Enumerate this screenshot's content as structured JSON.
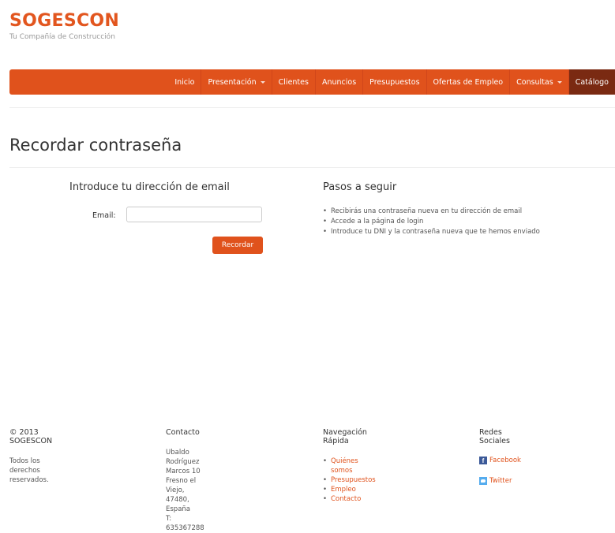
{
  "brand": {
    "name": "SOGESCON",
    "tagline": "Tu Compañía de Construcción"
  },
  "nav": {
    "items": [
      {
        "label": "Inicio",
        "dropdown": false,
        "active": false
      },
      {
        "label": "Presentación",
        "dropdown": true,
        "active": false
      },
      {
        "label": "Clientes",
        "dropdown": false,
        "active": false
      },
      {
        "label": "Anuncios",
        "dropdown": false,
        "active": false
      },
      {
        "label": "Presupuestos",
        "dropdown": false,
        "active": false
      },
      {
        "label": "Ofertas de Empleo",
        "dropdown": false,
        "active": false
      },
      {
        "label": "Consultas",
        "dropdown": true,
        "active": false
      },
      {
        "label": "Catálogo",
        "dropdown": false,
        "active": true
      }
    ]
  },
  "page": {
    "title": "Recordar contraseña"
  },
  "form": {
    "heading": "Introduce tu dirección de email",
    "email_label": "Email:",
    "email_value": "",
    "submit_label": "Recordar"
  },
  "steps": {
    "heading": "Pasos a seguir",
    "items": [
      "Recibirás una contraseña nueva en tu dirección de email",
      "Accede a la página de login",
      "Introduce tu DNI y la contraseña nueva que te hemos enviado"
    ]
  },
  "footer": {
    "copyright": {
      "heading": "© 2013 SOGESCON",
      "text": "Todos los derechos reservados."
    },
    "contact": {
      "heading": "Contacto",
      "lines": [
        "Ubaldo Rodríguez Marcos 10",
        "Fresno el Viejo, 47480, España",
        "T: 635367288"
      ]
    },
    "quicknav": {
      "heading": "Navegación Rápida",
      "links": [
        "Quiénes somos",
        "Presupuestos",
        "Empleo",
        "Contacto"
      ]
    },
    "social": {
      "heading": "Redes Sociales",
      "facebook": "Facebook",
      "twitter": "Twitter"
    }
  },
  "colors": {
    "accent": "#e0521c",
    "active_nav": "#7a2a12",
    "facebook": "#3b5998",
    "twitter": "#55acee"
  }
}
